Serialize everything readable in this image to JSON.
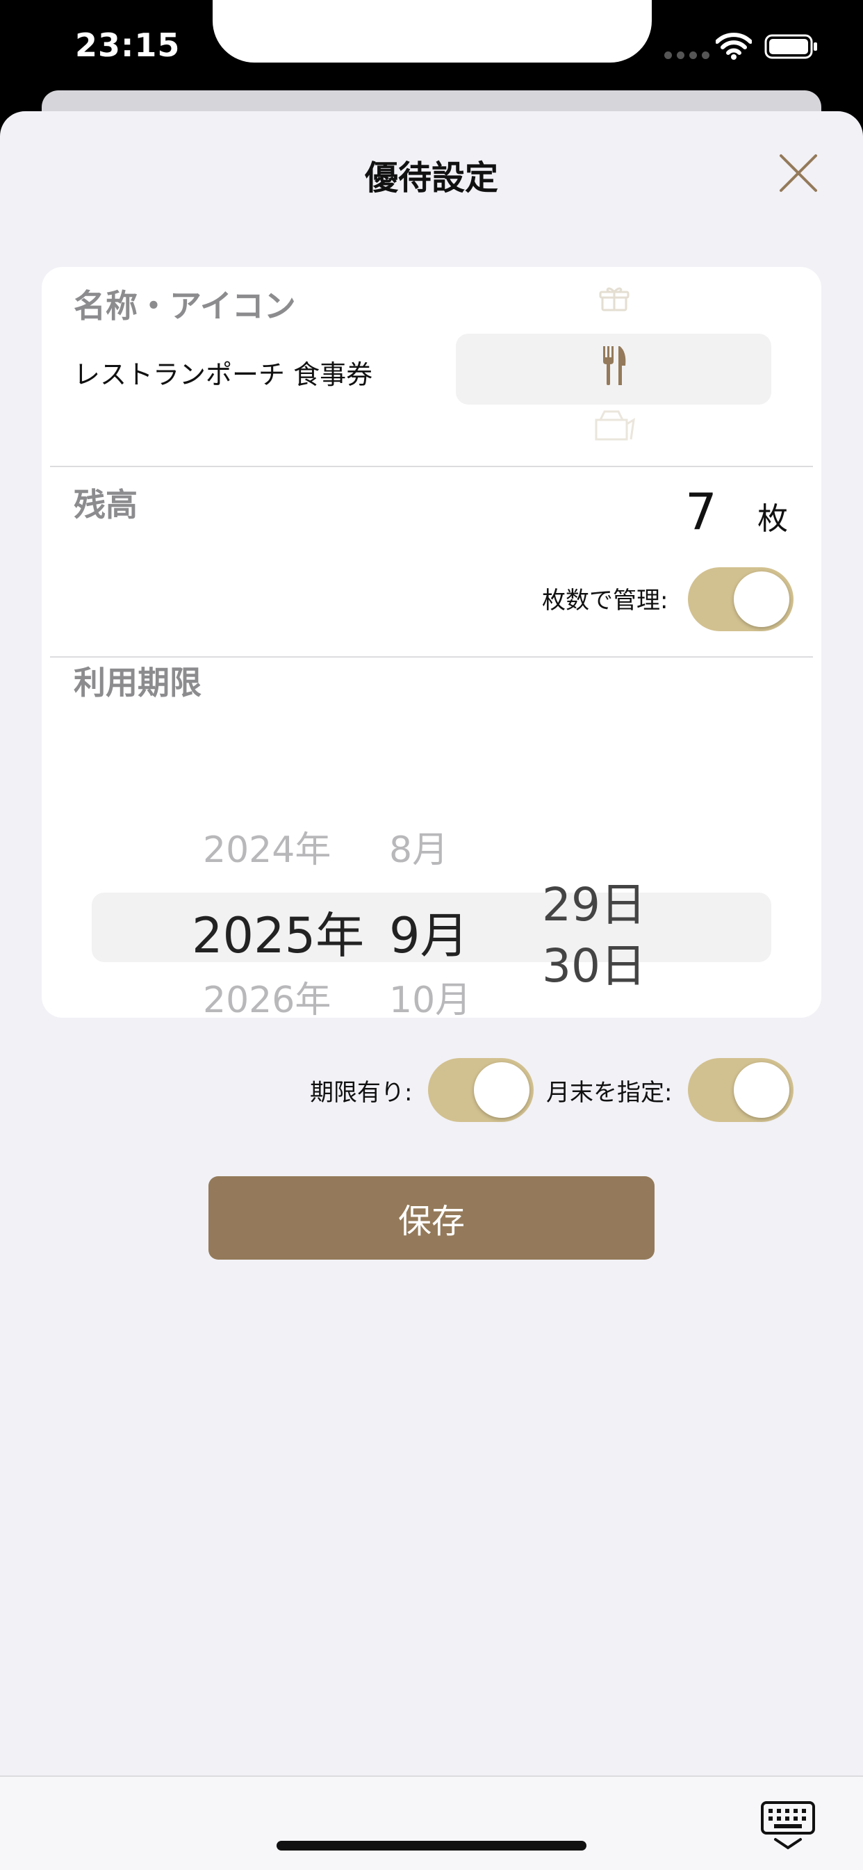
{
  "status": {
    "time": "23:15"
  },
  "header": {
    "title": "優待設定"
  },
  "name_section": {
    "label": "名称・アイコン",
    "name": "レストランポーチ 食事券",
    "icons": [
      "gift-icon",
      "fork-knife-icon",
      "bag-icon"
    ]
  },
  "balance_section": {
    "label": "残高",
    "value": "7",
    "unit": "枚",
    "toggle_label": "枚数で管理:",
    "toggle_on": true
  },
  "expiry_section": {
    "label": "利用期限",
    "year_prev": "2024年",
    "year_selected": "2025年",
    "year_next": "2026年",
    "month_prev": "8月",
    "month_selected": "9月",
    "month_next": "10月",
    "day_a": "29日",
    "day_b": "30日",
    "toggle_expiry_label": "期限有り:",
    "toggle_month_end_label": "月末を指定:",
    "toggle_expiry_on": true,
    "toggle_month_end_on": true
  },
  "actions": {
    "save_label": "保存"
  },
  "colors": {
    "accent": "#947a5a",
    "toggle": "#d2c190",
    "sheet": "#f2f1f6"
  }
}
